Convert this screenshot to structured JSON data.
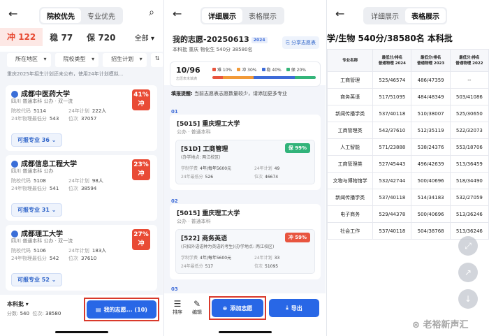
{
  "screen1": {
    "tabs": [
      "院校优先",
      "专业优先"
    ],
    "tiers": [
      {
        "label": "冲",
        "count": "122"
      },
      {
        "label": "稳",
        "count": "77"
      },
      {
        "label": "保",
        "count": "720"
      }
    ],
    "all_label": "全部",
    "filters": [
      "所在地区",
      "院校类型",
      "招生计划"
    ],
    "notice": "重庆2025年招生计划还未公布，使用24年计划模拟...",
    "schools": [
      {
        "name": "成都中医药大学",
        "sub": "四川  普通本科  公办 · 双一流",
        "code_label": "院校代码",
        "code": "5114",
        "plan_label": "24年计划",
        "plan": "222人",
        "score_label": "24年物理最低分",
        "score": "543",
        "rank_label": "位次",
        "rank": "37057",
        "rate": "41%",
        "tier": "冲",
        "avail_label": "可报专业",
        "avail": "36"
      },
      {
        "name": "成都信息工程大学",
        "sub": "四川  普通本科  公办",
        "code_label": "院校代码",
        "code": "5108",
        "plan_label": "24年计划",
        "plan": "98人",
        "score_label": "24年物理最低分",
        "score": "541",
        "rank_label": "位次",
        "rank": "38594",
        "rate": "23%",
        "tier": "冲",
        "avail_label": "可报专业",
        "avail": "31"
      },
      {
        "name": "成都理工大学",
        "sub": "四川  普通本科  公办 · 双一流",
        "code_label": "院校代码",
        "code": "5106",
        "plan_label": "24年计划",
        "plan": "183人",
        "score_label": "24年物理最低分",
        "score": "542",
        "rank_label": "位次",
        "rank": "37610",
        "rate": "27%",
        "tier": "冲",
        "avail_label": "可报专业",
        "avail": "52"
      }
    ],
    "bottom": {
      "batch": "本科批",
      "score_label": "分数:",
      "score": "540",
      "rank_label": "位次:",
      "rank": "38580",
      "my_btn": "我的志愿... (10)"
    }
  },
  "screen2": {
    "tabs": [
      "详细展示",
      "表格展示"
    ],
    "title": "我的志愿-20250613",
    "year_tag": "2024",
    "info": "本科批  重庆 物化生 540分 38580名",
    "share": "分享志愿表",
    "progress": {
      "count": "10/96",
      "label": "志愿表未填满",
      "legend": [
        {
          "name": "难",
          "pct": "10%",
          "color": "#e8553f",
          "value": 10
        },
        {
          "name": "冲",
          "pct": "30%",
          "color": "#f29a38",
          "value": 30
        },
        {
          "name": "稳",
          "pct": "40%",
          "color": "#3d6bd8",
          "value": 40
        },
        {
          "name": "保",
          "pct": "20%",
          "color": "#35b57a",
          "value": 20
        }
      ]
    },
    "tip_bold": "填报提醒:",
    "tip": "当前志愿表志愿数量较少，请添加更多专业",
    "groups": [
      {
        "no": "01",
        "school": "[5015] 重庆理工大学",
        "sub": "公办 · 普通本科",
        "major": "[51D] 工商管理",
        "note": "(办学地点: 两江校区)",
        "tag": "保 99%",
        "tag_color": "#31b37a",
        "fee_label": "学制学费",
        "fee": "4年/每年5600元",
        "plan_label": "24年计划",
        "plan": "49",
        "score_label": "24年最低分",
        "score": "526",
        "rank_label": "位次",
        "rank": "46674"
      },
      {
        "no": "02",
        "school": "[5015] 重庆理工大学",
        "sub": "公办 · 普通本科",
        "major": "[522] 商务英语",
        "note": "(只招外语语种为英语的考生)(办学地点: 两江校区)",
        "tag": "冲 59%",
        "tag_color": "#e8553f",
        "fee_label": "学制学费",
        "fee": "4年/每年5600元",
        "plan_label": "24年计划",
        "plan": "33",
        "score_label": "24年最低分",
        "score": "517",
        "rank_label": "位次",
        "rank": "51095"
      },
      {
        "no": "03"
      }
    ],
    "bottom": {
      "sort": "排序",
      "edit": "编辑",
      "add": "添加志愿",
      "export": "导出"
    }
  },
  "screen3": {
    "tabs": [
      "详细展示",
      "表格展示"
    ],
    "title": "学/生物 540分/38580名 本科批",
    "headers": [
      "专业名称",
      "最低分/排名\n普通物理 2024",
      "最低分/排名\n普通物理 2023",
      "最低分/排名\n普通物理 2022"
    ],
    "rows": [
      [
        "工商管理",
        "525/46574",
        "486/47359",
        "--"
      ],
      [
        "商务英语",
        "517/51095",
        "484/48349",
        "503/41086"
      ],
      [
        "新闻传播学类",
        "537/40118",
        "510/38007",
        "525/30650"
      ],
      [
        "工商管理类",
        "542/37610",
        "512/35119",
        "522/32073"
      ],
      [
        "人工智能",
        "571/23888",
        "538/24376",
        "553/18706"
      ],
      [
        "工商管理类",
        "527/45443",
        "496/42639",
        "513/36459"
      ],
      [
        "文物与博物馆学",
        "532/42744",
        "500/40696",
        "518/34490"
      ],
      [
        "新闻传播学类",
        "537/40118",
        "514/34183",
        "532/27059"
      ],
      [
        "电子商务",
        "529/44378",
        "500/40696",
        "513/36246"
      ],
      [
        "社会工作",
        "537/40118",
        "504/38768",
        "513/36246"
      ]
    ]
  },
  "watermark": "老裕新声汇"
}
